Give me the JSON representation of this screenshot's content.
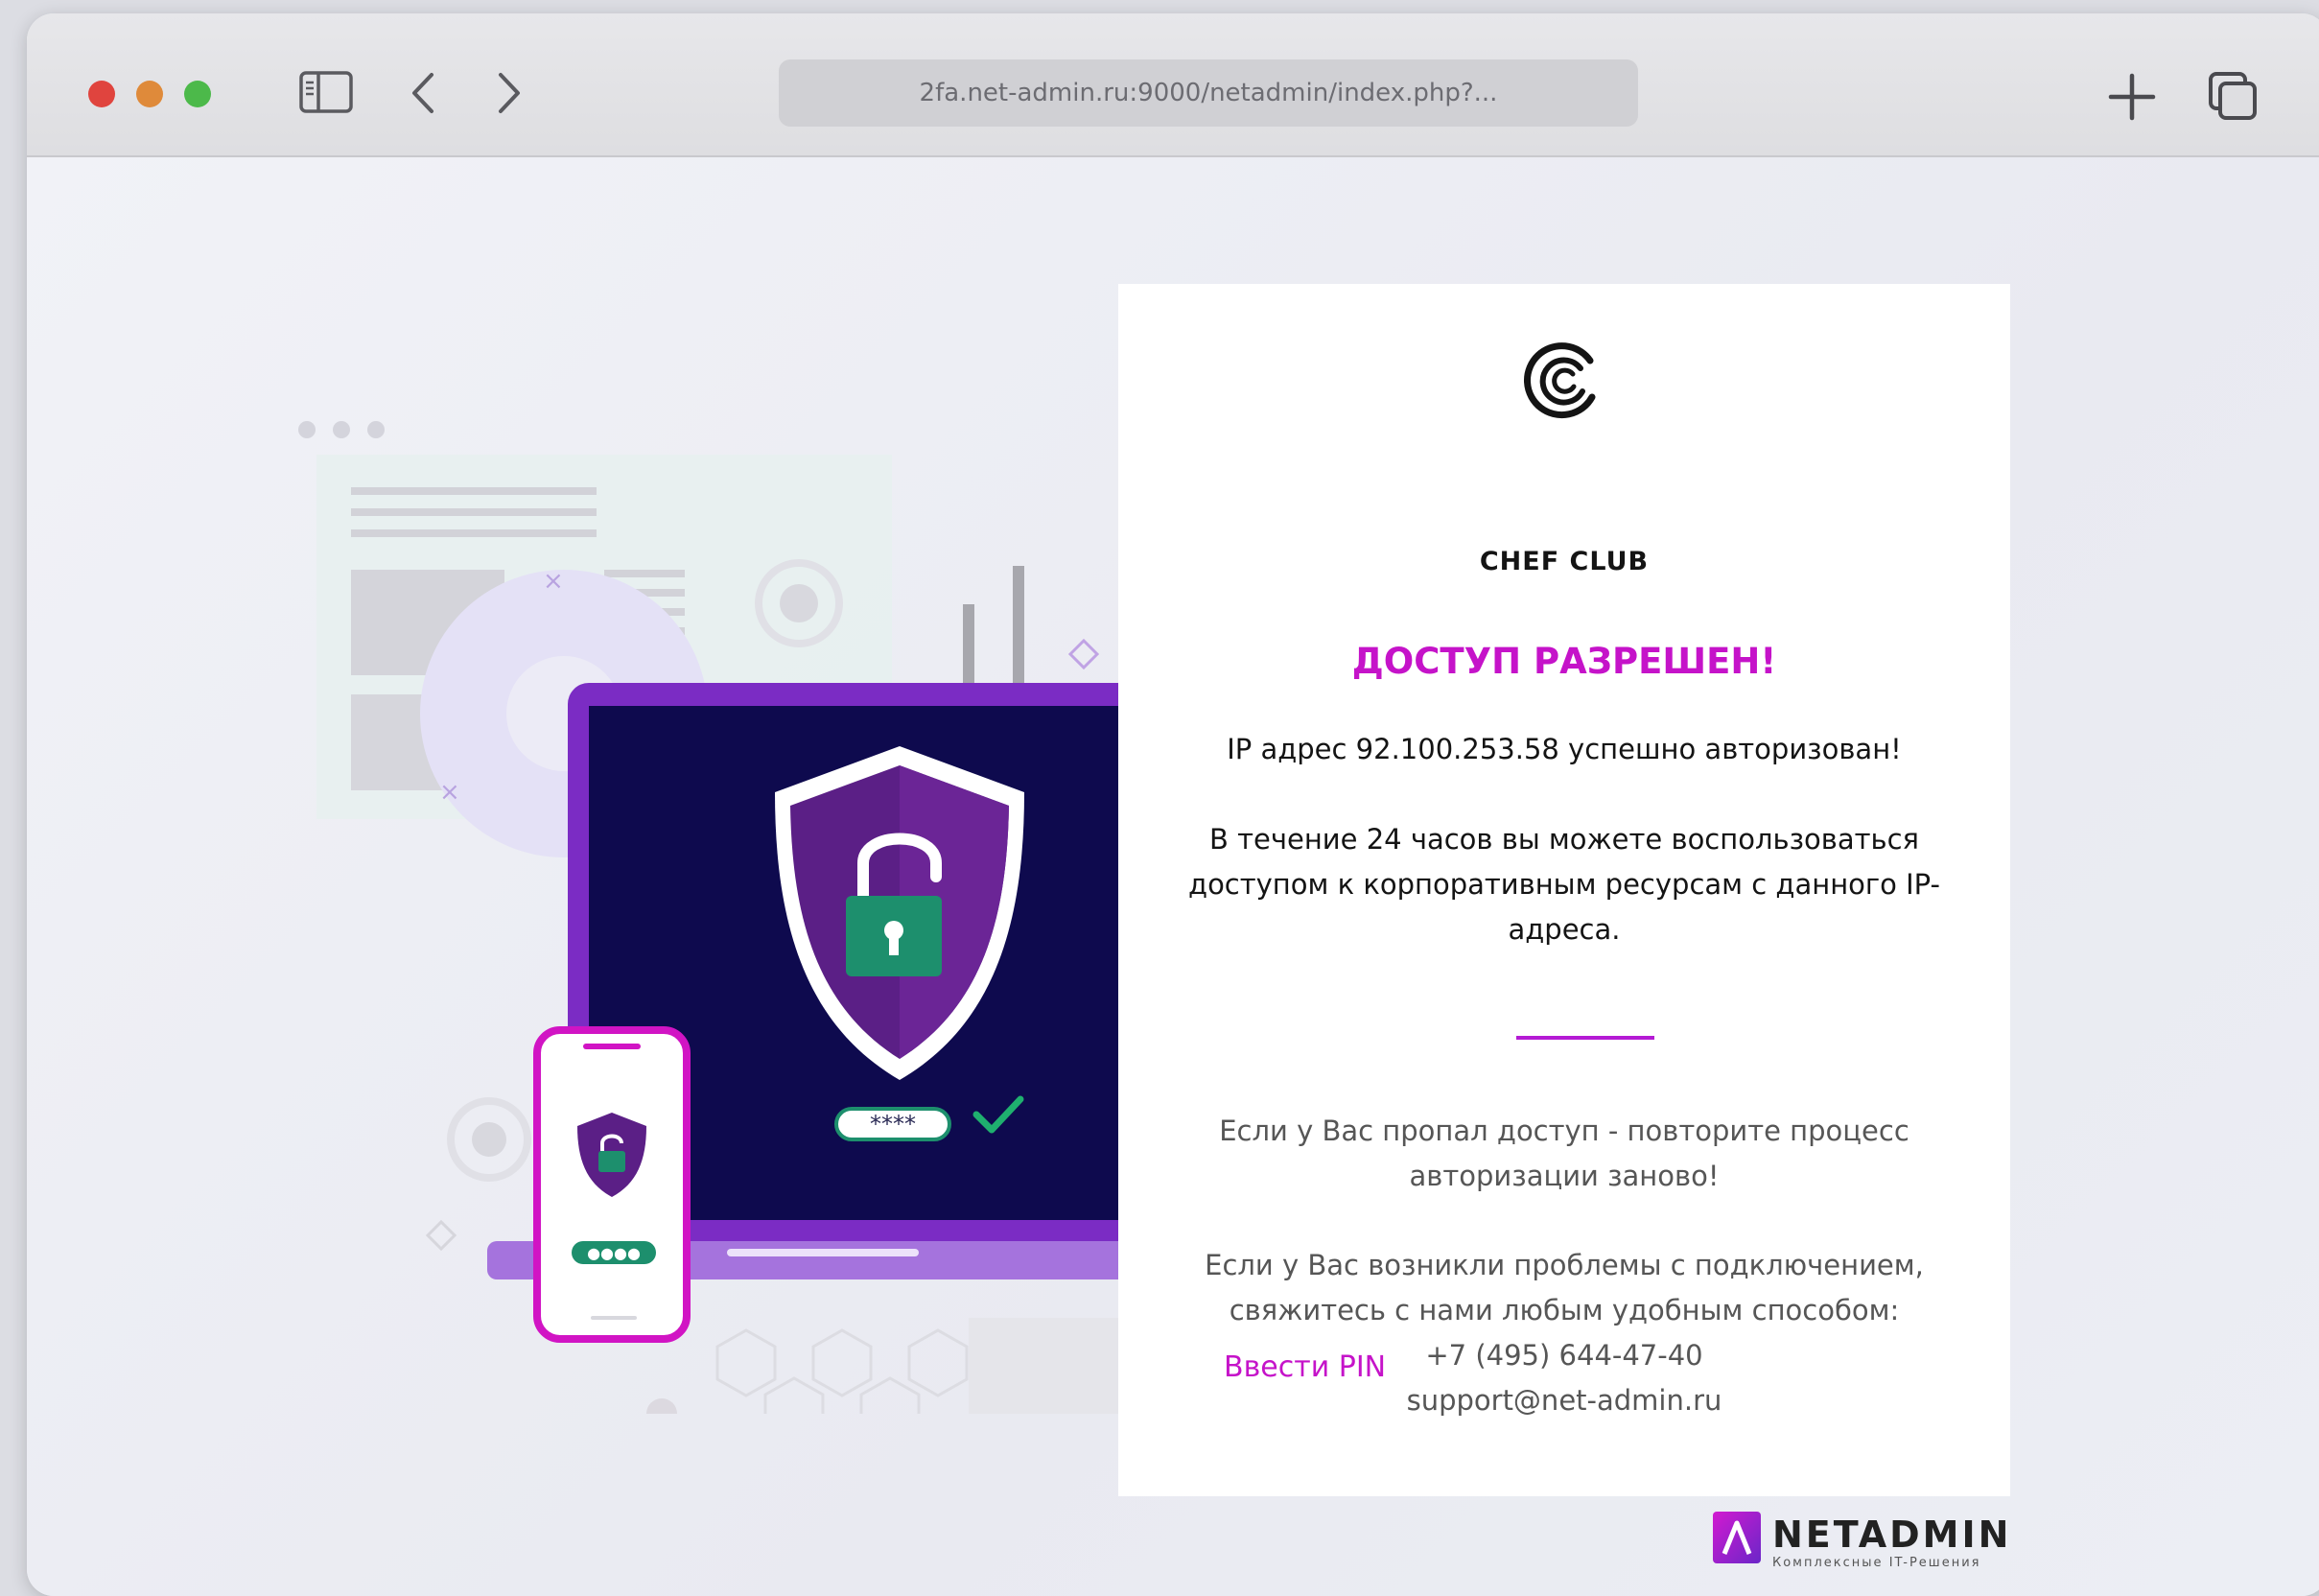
{
  "browser": {
    "url": "2fa.net-admin.ru:9000/netadmin/index.php?..."
  },
  "card": {
    "brand_name": "CHEF CLUB",
    "heading": "ДОСТУП РАЗРЕШЕН!",
    "ip_message": "IP адрес 92.100.253.58 успешно авторизован!",
    "access_message": "В течение 24 часов вы можете воспользоваться доступом к корпоративным ресурсам с данного IP-адреса.",
    "retry_message": "Если у Вас пропал доступ - повторите процесс авторизации заново!",
    "support_message": "Если у Вас возникли проблемы с подключением, свяжитесь с нами любым удобным способом:",
    "phone": "+7 (495) 644-47-40",
    "email": "support@net-admin.ru",
    "pin_link": "Ввести PIN"
  },
  "footer": {
    "company": "NETADMIN",
    "tagline": "Комплексные IT-Решения"
  },
  "illustration": {
    "password_mask": "****",
    "phone_pin_mask": "●●●●"
  },
  "colors": {
    "accent": "#c513c9",
    "laptop_purple": "#7b2cc4",
    "screen_navy": "#0e0a4e",
    "lock_green": "#1d8f6d"
  }
}
